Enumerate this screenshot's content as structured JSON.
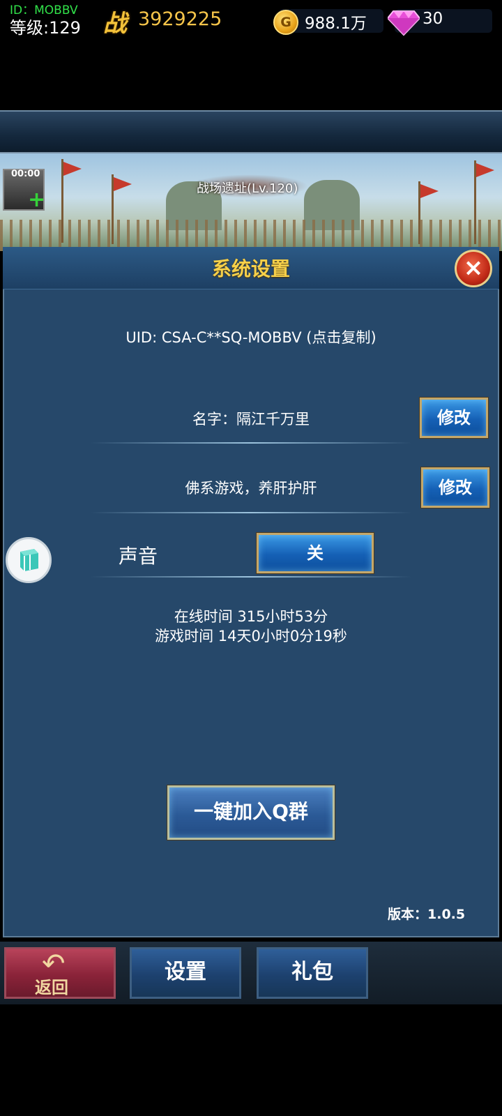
{
  "top_bar": {
    "player_id": "ID：MOBBV",
    "level": "等级:129",
    "battle_icon": "战",
    "battle_power": "3929225",
    "gold_icon": "G",
    "gold": "988.1万",
    "gems": "30",
    "colors": {
      "gold_text": "#f6c54a",
      "id_text": "#31e24a"
    }
  },
  "banner": {
    "skill_timer": "00:00",
    "stage_title": "战场遗址(Lv.120)"
  },
  "dialog": {
    "title": "系统设置",
    "close_icon": "×",
    "uid_text": "UID: CSA-C**SQ-MOBBV (点击复制)",
    "name_text": "名字：隔江千万里",
    "edit_label": "修改",
    "motto_text": "佛系游戏，养肝护肝",
    "sound_label": "声音",
    "sound_toggle": "关",
    "online_time": "在线时间 315小时53分",
    "game_time": "游戏时间 14天0小时0分19秒",
    "qq_group_button": "一键加入Q群",
    "version": "版本：1.0.5"
  },
  "bottom_bar": {
    "back_label": "返回",
    "settings_label": "设置",
    "gift_label": "礼包"
  }
}
